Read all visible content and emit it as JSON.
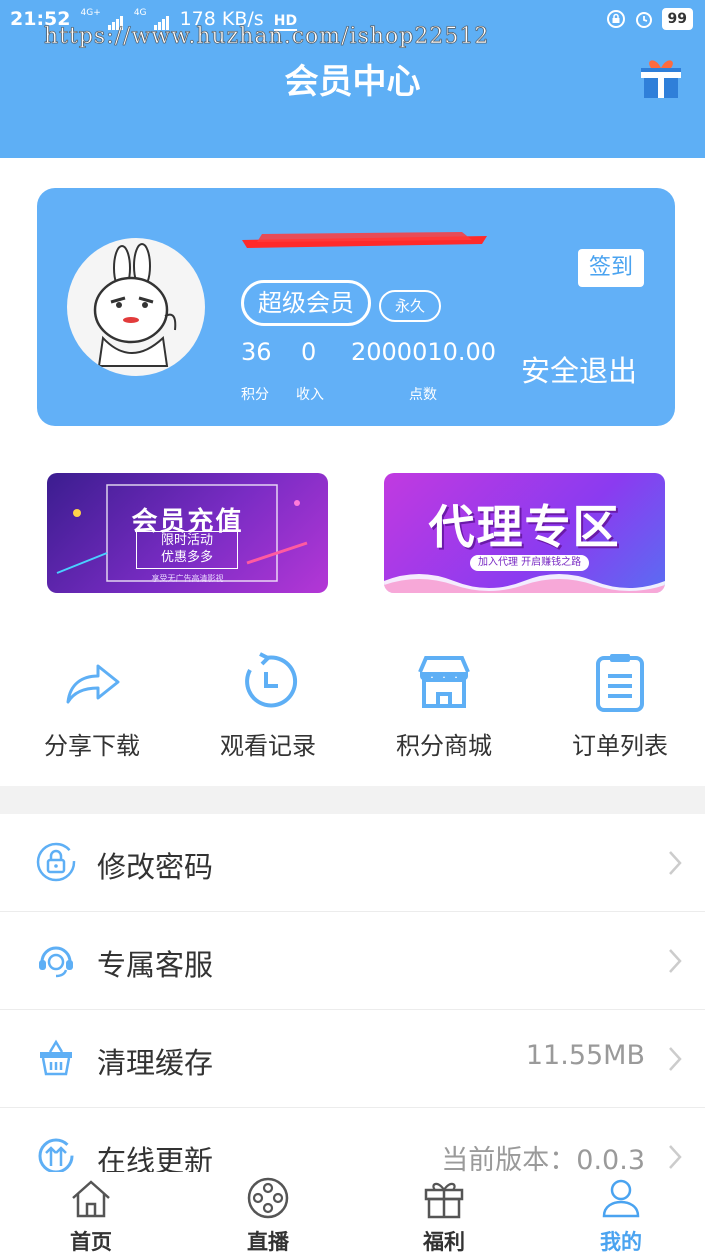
{
  "status_bar": {
    "time": "21:52",
    "network_1": "4G+",
    "network_2": "4G",
    "speed": "178 KB/s",
    "hd": "HD",
    "battery": "99"
  },
  "watermark": "https://www.huzhan.com/ishop22512",
  "header": {
    "title": "会员中心",
    "gift_icon": "gift-icon"
  },
  "member": {
    "level": "超级会员",
    "duration": "永久",
    "signin_label": "签到",
    "logout_label": "安全退出",
    "stats": [
      {
        "value": "36",
        "label": "积分"
      },
      {
        "value": "0",
        "label": "收入"
      },
      {
        "value": "2000010.00",
        "label": "点数"
      }
    ]
  },
  "banners": {
    "recharge": {
      "title": "会员充值",
      "box_line1": "限时活动",
      "box_line2": "优惠多多",
      "footer": "享受无广告高清影视"
    },
    "agent": {
      "title": "代理专区",
      "sub": "加入代理 开启赚钱之路"
    }
  },
  "quick_actions": [
    {
      "label": "分享下载",
      "icon": "share-icon"
    },
    {
      "label": "观看记录",
      "icon": "history-icon"
    },
    {
      "label": "积分商城",
      "icon": "store-icon"
    },
    {
      "label": "订单列表",
      "icon": "order-list-icon"
    }
  ],
  "settings": [
    {
      "label": "修改密码",
      "value": "",
      "icon": "lock-icon"
    },
    {
      "label": "专属客服",
      "value": "",
      "icon": "headset-icon"
    },
    {
      "label": "清理缓存",
      "value": "11.55MB",
      "icon": "basket-icon"
    },
    {
      "label": "在线更新",
      "value": "当前版本：0.0.3",
      "icon": "update-icon"
    }
  ],
  "tabbar": [
    {
      "label": "首页",
      "icon": "home-icon",
      "active": false
    },
    {
      "label": "直播",
      "icon": "film-reel-icon",
      "active": false
    },
    {
      "label": "福利",
      "icon": "gift-icon",
      "active": false
    },
    {
      "label": "我的",
      "icon": "user-icon",
      "active": true
    }
  ],
  "colors": {
    "primary": "#5eaff5",
    "card": "#62b0f7",
    "accent_text": "#4aa3f0"
  }
}
